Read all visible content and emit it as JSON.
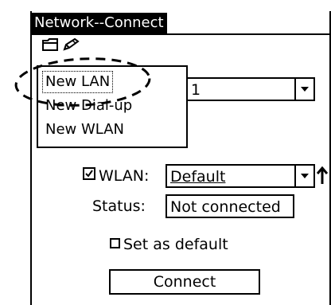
{
  "window": {
    "title": "Network--Connect"
  },
  "toolbar": {
    "menu_icon": "menu-icon",
    "edit_icon": "edit-pencil-icon"
  },
  "popup_menu": {
    "items": [
      {
        "label": "New LAN",
        "selected": true
      },
      {
        "label": "New Dial-up",
        "selected": false
      },
      {
        "label": "New WLAN",
        "selected": false
      }
    ]
  },
  "top_dropdown": {
    "value": "1"
  },
  "wlan": {
    "label": "WLAN:",
    "checked": true,
    "value": "Default"
  },
  "status": {
    "label": "Status:",
    "value": "Not connected"
  },
  "set_default": {
    "label": "Set as default",
    "checked": false
  },
  "connect": {
    "label": "Connect"
  },
  "colors": {
    "foreground": "#000000",
    "background": "#ffffff"
  }
}
